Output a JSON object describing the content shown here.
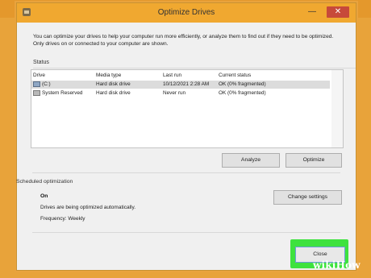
{
  "window": {
    "title": "Optimize Drives",
    "minimize_glyph": "—",
    "close_glyph": "✕"
  },
  "intro": "You can optimize your drives to help your computer run more efficiently, or analyze them to find out if they need to be optimized. Only drives on or connected to your computer are shown.",
  "status": {
    "label": "Status",
    "columns": [
      "Drive",
      "Media type",
      "Last run",
      "Current status"
    ],
    "rows": [
      {
        "drive": "(C:)",
        "icon": "hard-drive-icon",
        "media": "Hard disk drive",
        "last_run": "10/12/2021 2:28 AM",
        "status": "OK (0% fragmented)",
        "selected": true
      },
      {
        "drive": "System Reserved",
        "icon": "system-drive-icon",
        "media": "Hard disk drive",
        "last_run": "Never run",
        "status": "OK (0% fragmented)",
        "selected": false
      }
    ]
  },
  "buttons": {
    "analyze": "Analyze",
    "optimize": "Optimize",
    "change_settings": "Change settings",
    "close": "Close"
  },
  "scheduled": {
    "label": "Scheduled optimization",
    "state": "On",
    "description": "Drives are being optimized automatically.",
    "frequency": "Frequency: Weekly"
  },
  "watermark": {
    "wiki": "wiki",
    "how": "How"
  },
  "colors": {
    "titlebar": "#f0a830",
    "close_highlight": "#3ee23e",
    "close_button": "#c7493a"
  }
}
